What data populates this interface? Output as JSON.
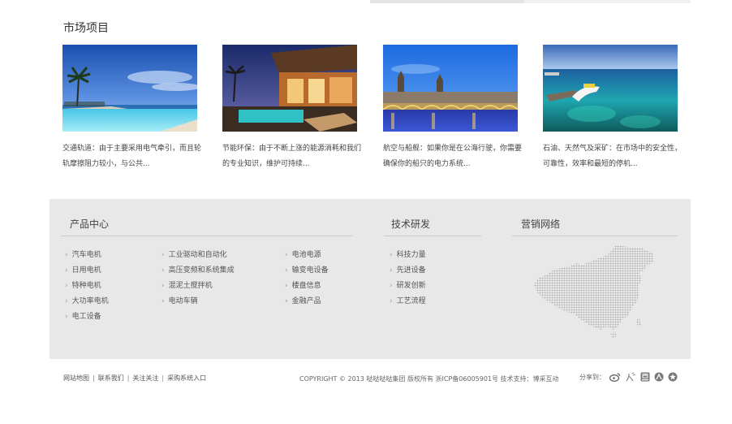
{
  "market": {
    "title": "市场项目",
    "cards": [
      {
        "desc": "交通轨道：由于主要采用电气牵引，而且轮轨摩擦阻力较小，与公共..."
      },
      {
        "desc": "节能环保：由于不断上涨的能源消耗和我们的专业知识，维护可持续..."
      },
      {
        "desc": "航空与船舰：如果你是在公海行驶，你需要确保你的船只的电力系统..."
      },
      {
        "desc": "石油、天然气及采矿：在市场中的安全性，可靠性，效率和最短的停机..."
      }
    ]
  },
  "footer": {
    "products_title": "产品中心",
    "products_col1": [
      "汽车电机",
      "日用电机",
      "特种电机",
      "大功率电机",
      "电工设备"
    ],
    "products_col2": [
      "工业驱动和自动化",
      "高压变频和系统集成",
      "混泥土搅拌机",
      "电动车辆"
    ],
    "products_col3": [
      "电池电源",
      "输变电设备",
      "楼盘信息",
      "金融产品"
    ],
    "tech_title": "技术研发",
    "tech_links": [
      "科技力量",
      "先进设备",
      "研发创新",
      "工艺流程"
    ],
    "sales_title": "营销网络",
    "arrow": "›"
  },
  "bottom": {
    "links": [
      "网站地图",
      "联系我们",
      "关注关注",
      "采购系统入口"
    ],
    "separator": "|",
    "copyright": "COPYRIGHT © 2013 哒哒哒哒集团 版权所有 浙ICP备06005901号 技术支持：博采互动",
    "share_label": "分享到：",
    "share_icons": [
      "weibo-icon",
      "renren-icon",
      "douban-icon",
      "kaixin-icon",
      "qzone-icon"
    ]
  }
}
